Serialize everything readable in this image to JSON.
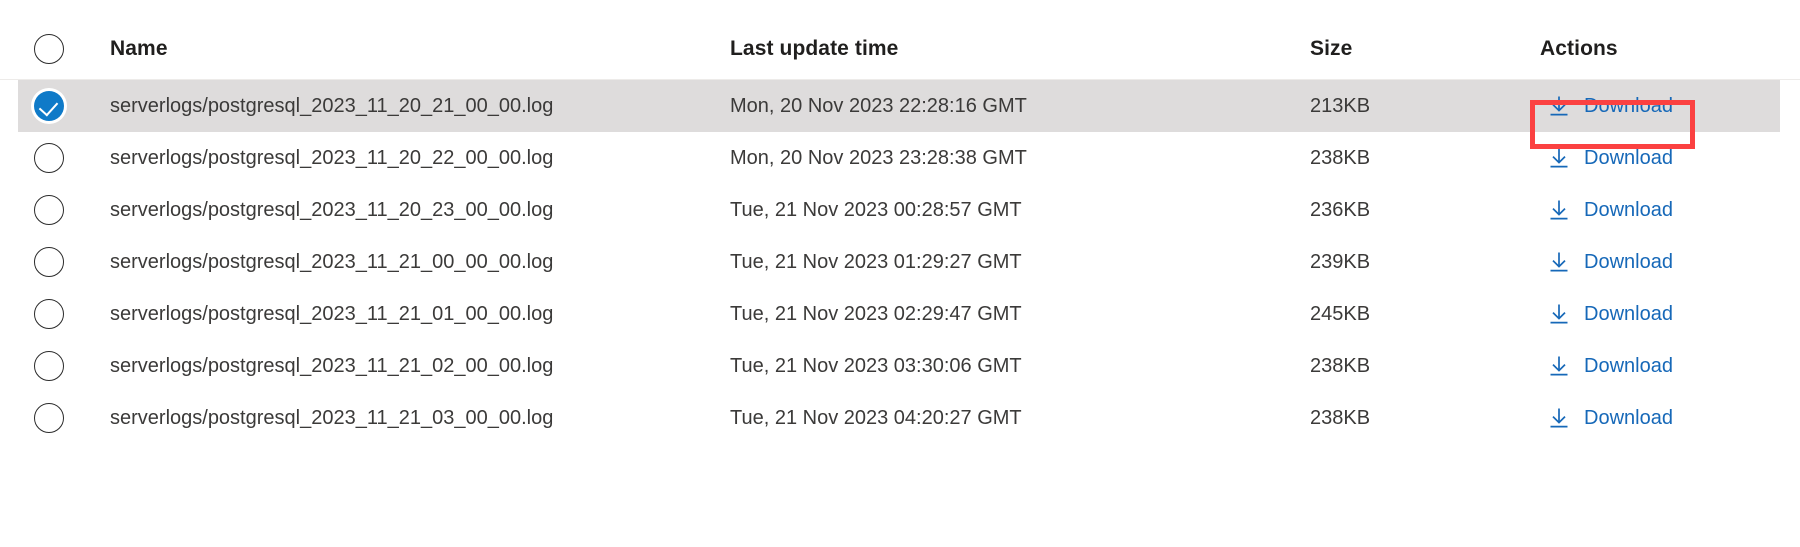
{
  "table": {
    "columns": [
      {
        "key": "select",
        "label": ""
      },
      {
        "key": "name",
        "label": "Name"
      },
      {
        "key": "last_update_time",
        "label": "Last update time"
      },
      {
        "key": "size",
        "label": "Size"
      },
      {
        "key": "actions",
        "label": "Actions"
      }
    ],
    "select_all_icon": "radio-unchecked-icon",
    "rows": [
      {
        "selected": true,
        "select_icon": "check-circle-filled-icon",
        "name": "serverlogs/postgresql_2023_11_20_21_00_00.log",
        "last_update_time": "Mon, 20 Nov 2023 22:28:16 GMT",
        "size": "213KB",
        "action_label": "Download",
        "action_icon": "download-arrow-icon",
        "highlighted": true
      },
      {
        "selected": false,
        "select_icon": "radio-unchecked-icon",
        "name": "serverlogs/postgresql_2023_11_20_22_00_00.log",
        "last_update_time": "Mon, 20 Nov 2023 23:28:38 GMT",
        "size": "238KB",
        "action_label": "Download",
        "action_icon": "download-arrow-icon",
        "highlighted": false
      },
      {
        "selected": false,
        "select_icon": "radio-unchecked-icon",
        "name": "serverlogs/postgresql_2023_11_20_23_00_00.log",
        "last_update_time": "Tue, 21 Nov 2023 00:28:57 GMT",
        "size": "236KB",
        "action_label": "Download",
        "action_icon": "download-arrow-icon",
        "highlighted": false
      },
      {
        "selected": false,
        "select_icon": "radio-unchecked-icon",
        "name": "serverlogs/postgresql_2023_11_21_00_00_00.log",
        "last_update_time": "Tue, 21 Nov 2023 01:29:27 GMT",
        "size": "239KB",
        "action_label": "Download",
        "action_icon": "download-arrow-icon",
        "highlighted": false
      },
      {
        "selected": false,
        "select_icon": "radio-unchecked-icon",
        "name": "serverlogs/postgresql_2023_11_21_01_00_00.log",
        "last_update_time": "Tue, 21 Nov 2023 02:29:47 GMT",
        "size": "245KB",
        "action_label": "Download",
        "action_icon": "download-arrow-icon",
        "highlighted": false
      },
      {
        "selected": false,
        "select_icon": "radio-unchecked-icon",
        "name": "serverlogs/postgresql_2023_11_21_02_00_00.log",
        "last_update_time": "Tue, 21 Nov 2023 03:30:06 GMT",
        "size": "238KB",
        "action_label": "Download",
        "action_icon": "download-arrow-icon",
        "highlighted": false
      },
      {
        "selected": false,
        "select_icon": "radio-unchecked-icon",
        "name": "serverlogs/postgresql_2023_11_21_03_00_00.log",
        "last_update_time": "Tue, 21 Nov 2023 04:20:27 GMT",
        "size": "238KB",
        "action_label": "Download",
        "action_icon": "download-arrow-icon",
        "highlighted": false
      }
    ]
  },
  "colors": {
    "link": "#1668b8",
    "selected_row_bg": "#dedcdc",
    "checkbox_checked": "#0f7ac8",
    "highlight_border": "#fb4141",
    "text": "#3b3a39",
    "header_text": "#201f1e"
  }
}
